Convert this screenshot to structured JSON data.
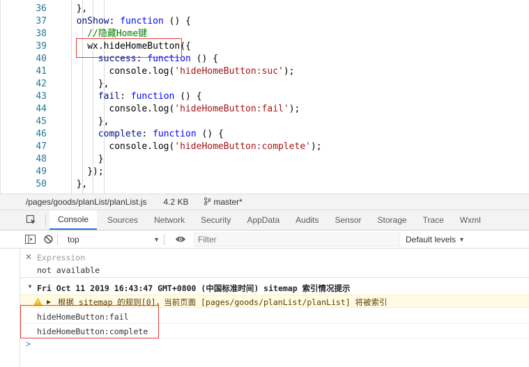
{
  "editor": {
    "lines": [
      {
        "num": "36",
        "indent": 1,
        "tokens": [
          {
            "t": "},",
            "c": "punc"
          }
        ]
      },
      {
        "num": "37",
        "indent": 1,
        "tokens": [
          {
            "t": "onShow",
            "c": "key"
          },
          {
            "t": ": ",
            "c": "punc"
          },
          {
            "t": "function",
            "c": "kw"
          },
          {
            "t": " () {",
            "c": "punc"
          }
        ]
      },
      {
        "num": "38",
        "indent": 2,
        "tokens": [
          {
            "t": "//隐藏Home键",
            "c": "cmt"
          }
        ]
      },
      {
        "num": "39",
        "indent": 2,
        "tokens": [
          {
            "t": "wx.hideHomeButton({",
            "c": "fn"
          }
        ]
      },
      {
        "num": "40",
        "indent": 3,
        "tokens": [
          {
            "t": "success",
            "c": "key"
          },
          {
            "t": ": ",
            "c": "punc"
          },
          {
            "t": "function",
            "c": "kw"
          },
          {
            "t": " () {",
            "c": "punc"
          }
        ]
      },
      {
        "num": "41",
        "indent": 4,
        "tokens": [
          {
            "t": "console.log(",
            "c": "fn"
          },
          {
            "t": "'hideHomeButton:suc'",
            "c": "str"
          },
          {
            "t": ");",
            "c": "punc"
          }
        ]
      },
      {
        "num": "42",
        "indent": 3,
        "tokens": [
          {
            "t": "},",
            "c": "punc"
          }
        ]
      },
      {
        "num": "43",
        "indent": 3,
        "tokens": [
          {
            "t": "fail",
            "c": "key"
          },
          {
            "t": ": ",
            "c": "punc"
          },
          {
            "t": "function",
            "c": "kw"
          },
          {
            "t": " () {",
            "c": "punc"
          }
        ]
      },
      {
        "num": "44",
        "indent": 4,
        "tokens": [
          {
            "t": "console.log(",
            "c": "fn"
          },
          {
            "t": "'hideHomeButton:fail'",
            "c": "str"
          },
          {
            "t": ");",
            "c": "punc"
          }
        ]
      },
      {
        "num": "45",
        "indent": 3,
        "tokens": [
          {
            "t": "},",
            "c": "punc"
          }
        ]
      },
      {
        "num": "46",
        "indent": 3,
        "tokens": [
          {
            "t": "complete",
            "c": "key"
          },
          {
            "t": ": ",
            "c": "punc"
          },
          {
            "t": "function",
            "c": "kw"
          },
          {
            "t": " () {",
            "c": "punc"
          }
        ]
      },
      {
        "num": "47",
        "indent": 4,
        "tokens": [
          {
            "t": "console.log(",
            "c": "fn"
          },
          {
            "t": "'hideHomeButton:complete'",
            "c": "str"
          },
          {
            "t": ");",
            "c": "punc"
          }
        ]
      },
      {
        "num": "48",
        "indent": 3,
        "tokens": [
          {
            "t": "}",
            "c": "punc"
          }
        ]
      },
      {
        "num": "49",
        "indent": 2,
        "tokens": [
          {
            "t": "});",
            "c": "punc"
          }
        ]
      },
      {
        "num": "50",
        "indent": 1,
        "tokens": [
          {
            "t": "},",
            "c": "punc"
          }
        ]
      }
    ]
  },
  "statusbar": {
    "file_path": "/pages/goods/planList/planList.js",
    "file_size": "4.2 KB",
    "branch": "master*"
  },
  "devtools": {
    "tabs": [
      "Console",
      "Sources",
      "Network",
      "Security",
      "AppData",
      "Audits",
      "Sensor",
      "Storage",
      "Trace",
      "Wxml"
    ],
    "active_tab": "Console"
  },
  "console_toolbar": {
    "context": "top",
    "filter_placeholder": "Filter",
    "levels": "Default levels"
  },
  "console": {
    "expression_label": "Expression",
    "expression_value": "not available",
    "group_header": "Fri Oct 11 2019 16:43:47 GMT+0800 (中国标准时间) sitemap 索引情况提示",
    "warning": "根据 sitemap 的规则[0]，当前页面 [pages/goods/planList/planList] 将被索引",
    "logs": [
      "hideHomeButton:fail",
      "hideHomeButton:complete"
    ],
    "prompt": ">"
  },
  "colors": {
    "highlight_box": "#e53935",
    "active_tab_underline": "#1a73e8",
    "warning_bg": "#fffbe5"
  }
}
